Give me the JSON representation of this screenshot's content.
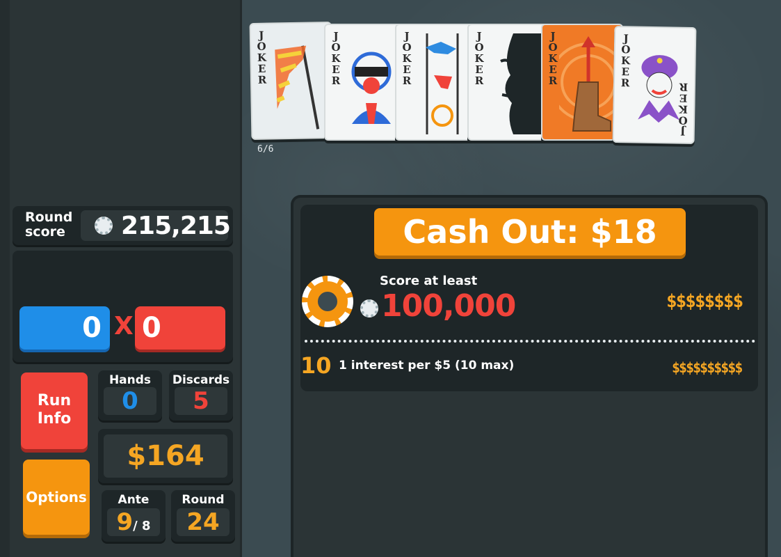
{
  "jokers": {
    "label": "JOKER",
    "count_text": "6/6",
    "cards": [
      {
        "name": "windsock-joker",
        "bg": "#e9eef0"
      },
      {
        "name": "stuntman-joker",
        "bg": "#f4f6f6"
      },
      {
        "name": "acrobat-joker",
        "bg": "#f4f6f6"
      },
      {
        "name": "shadow-face-joker",
        "bg": "#f4f6f6"
      },
      {
        "name": "cowboy-boot-joker",
        "bg": "#f07a26"
      },
      {
        "name": "fortune-teller-joker",
        "bg": "#f4f6f6"
      }
    ]
  },
  "round_score": {
    "label": "Round\nscore",
    "value": "215,215",
    "icon": "chip-icon"
  },
  "hand": {
    "chips": "0",
    "x": "X",
    "mult": "0"
  },
  "buttons": {
    "run_info": "Run\nInfo",
    "options": "Options",
    "cash_out": "Cash Out: $18"
  },
  "stats": {
    "hands_label": "Hands",
    "hands_value": "0",
    "discards_label": "Discards",
    "discards_value": "5",
    "money": "$164",
    "ante_label": "Ante",
    "ante_value": "9",
    "ante_max": "/ 8",
    "round_label": "Round",
    "round_value": "24"
  },
  "cashout": {
    "score_label": "Score at least",
    "target": "100,000",
    "blind_reward": "$$$$$$$$",
    "interest_amount": "10",
    "interest_text": "1 interest per $5 (10 max)",
    "interest_dollars": "$$$$$$$$$$"
  },
  "colors": {
    "chips": "#1f8ee8",
    "mult": "#f0433a",
    "money": "#f5a623",
    "accent_orange": "#f5950f"
  }
}
